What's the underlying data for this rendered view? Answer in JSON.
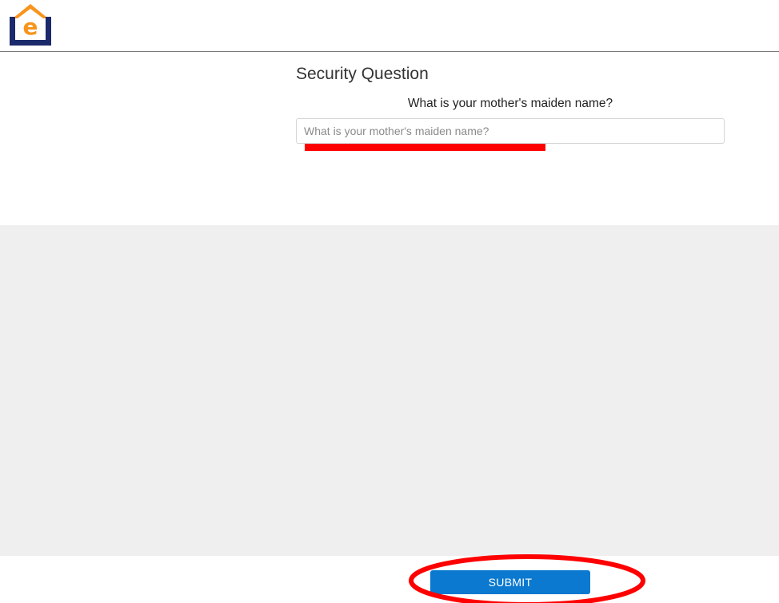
{
  "header": {
    "logo_letter": "e",
    "logo_colors": {
      "roof": "#f7941d",
      "letter": "#f7941d",
      "frame": "#1b2a6b"
    }
  },
  "form": {
    "title": "Security Question",
    "question": "What is your mother's maiden name?",
    "answer_value": "",
    "answer_placeholder": "What is your mother's maiden name?"
  },
  "actions": {
    "submit_label": "SUBMIT"
  },
  "colors": {
    "accent": "#0a79cf",
    "annotation": "#ff0000",
    "panel": "#efefef"
  }
}
